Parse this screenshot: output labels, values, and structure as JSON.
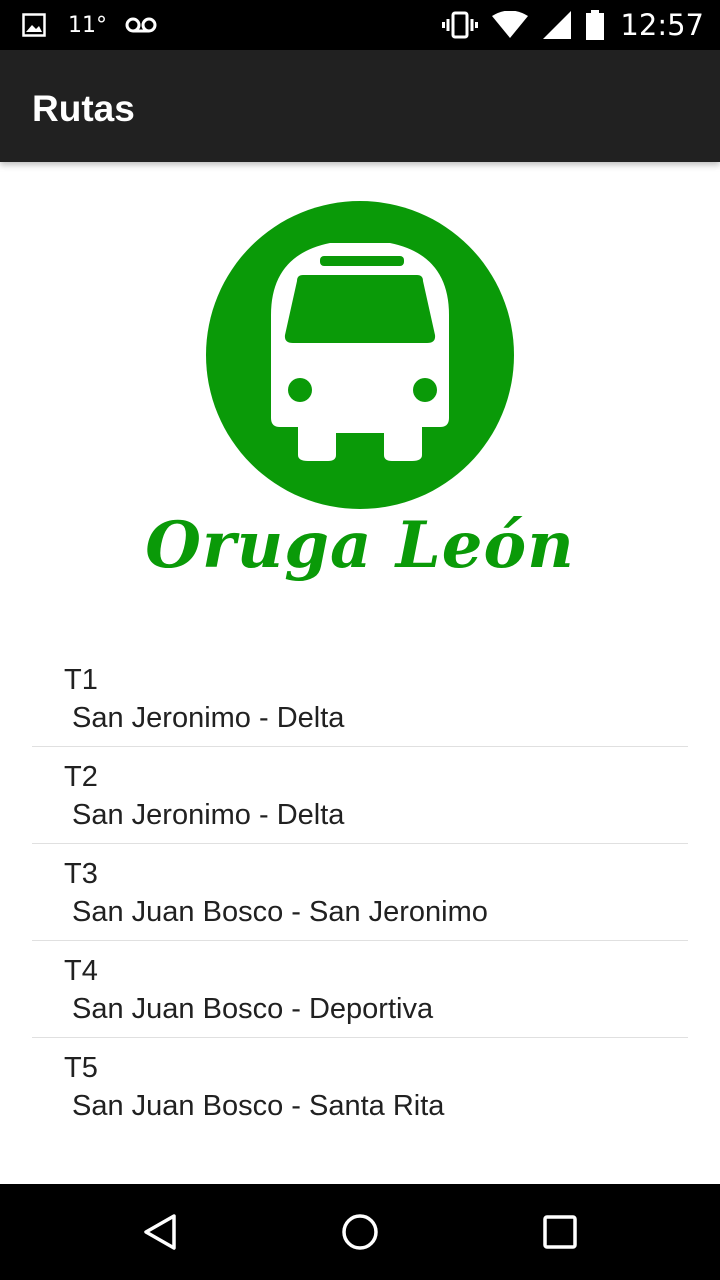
{
  "status_bar": {
    "temperature": "11°",
    "time": "12:57",
    "icons": [
      "image-icon",
      "voicemail-icon",
      "vibrate-icon",
      "wifi-icon",
      "signal-icon",
      "battery-icon"
    ]
  },
  "app_bar": {
    "title": "Rutas"
  },
  "logo": {
    "brand_text": "Oruga León",
    "color": "#0a9a08"
  },
  "routes": [
    {
      "code": "T1",
      "name": " San Jeronimo - Delta"
    },
    {
      "code": "T2",
      "name": " San Jeronimo - Delta"
    },
    {
      "code": "T3",
      "name": " San Juan Bosco - San Jeronimo"
    },
    {
      "code": "T4",
      "name": " San Juan Bosco - Deportiva"
    },
    {
      "code": "T5",
      "name": " San Juan Bosco - Santa Rita"
    }
  ],
  "nav_bar": {
    "icons": [
      "back-icon",
      "home-icon",
      "recents-icon"
    ]
  }
}
